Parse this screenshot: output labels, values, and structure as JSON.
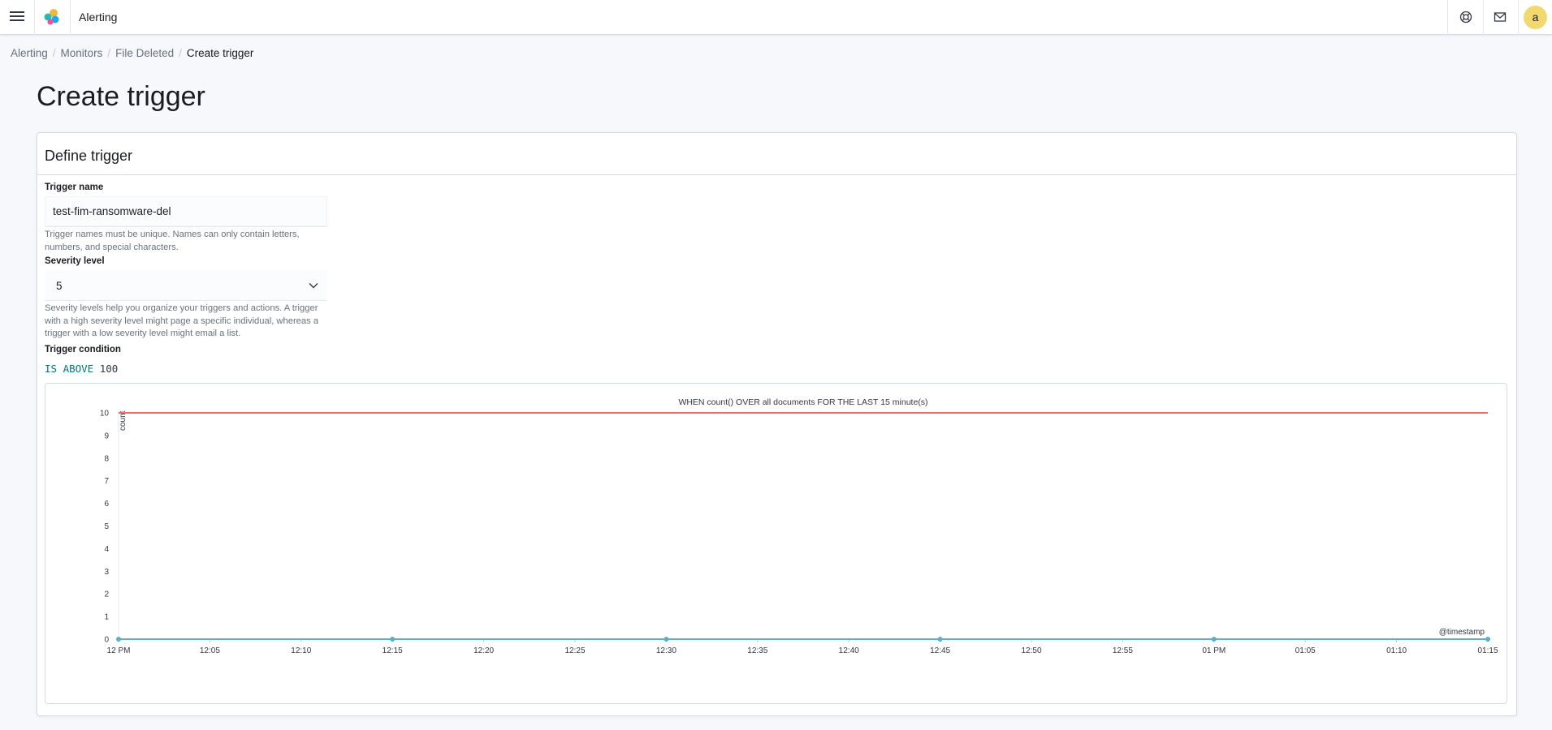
{
  "header": {
    "app_title": "Alerting",
    "avatar_initial": "a",
    "icons": [
      "menu-icon",
      "elastic-logo",
      "help-icon",
      "mail-icon"
    ]
  },
  "breadcrumbs": {
    "items": [
      "Alerting",
      "Monitors",
      "File Deleted"
    ],
    "current": "Create trigger"
  },
  "page": {
    "title": "Create trigger"
  },
  "panel": {
    "title": "Define trigger",
    "trigger_name": {
      "label": "Trigger name",
      "value": "test-fim-ransomware-del",
      "help": "Trigger names must be unique. Names can only contain letters, numbers, and special characters."
    },
    "severity": {
      "label": "Severity level",
      "value": "5",
      "help": "Severity levels help you organize your triggers and actions. A trigger with a high severity level might page a specific individual, whereas a trigger with a low severity level might email a list."
    },
    "condition": {
      "label": "Trigger condition",
      "keyword": "IS ABOVE",
      "value": "100"
    }
  },
  "chart_data": {
    "type": "line",
    "title": "WHEN count() OVER all documents FOR THE LAST 15 minute(s)",
    "ylabel": "count",
    "xlabel": "@timestamp",
    "ylim": [
      0,
      10
    ],
    "yticks": [
      "0",
      "1",
      "2",
      "3",
      "4",
      "5",
      "6",
      "7",
      "8",
      "9",
      "10"
    ],
    "xticks": [
      "12 PM",
      "12:05",
      "12:10",
      "12:15",
      "12:20",
      "12:25",
      "12:30",
      "12:35",
      "12:40",
      "12:45",
      "12:50",
      "12:55",
      "01 PM",
      "01:05",
      "01:10",
      "01:15"
    ],
    "series": [
      {
        "x": [
          "12 PM",
          "12:15",
          "12:30",
          "12:45",
          "01 PM",
          "01:15"
        ],
        "values": [
          0,
          0,
          0,
          0,
          0,
          0
        ],
        "color": "#54b3c6"
      }
    ],
    "threshold": {
      "value": 10,
      "color": "#f06b6b"
    },
    "grid": false
  }
}
